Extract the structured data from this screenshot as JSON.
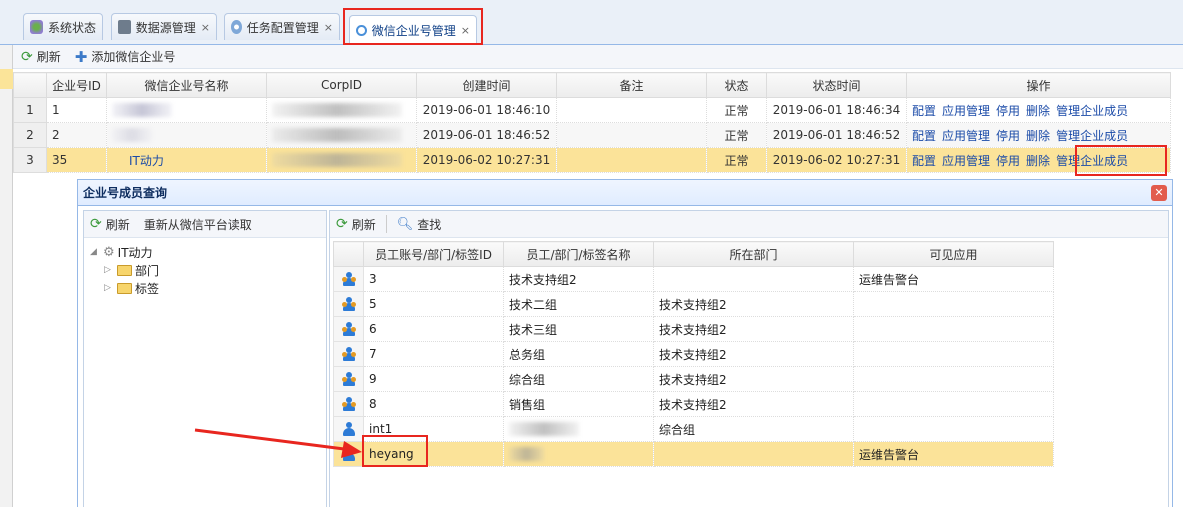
{
  "tabs": [
    {
      "label": "系统状态",
      "closable": false
    },
    {
      "label": "数据源管理",
      "closable": true
    },
    {
      "label": "任务配置管理",
      "closable": true
    },
    {
      "label": "微信企业号管理",
      "closable": true,
      "active": true
    }
  ],
  "toolbar": {
    "refresh": "刷新",
    "add": "添加微信企业号"
  },
  "grid": {
    "headers": [
      "企业号ID",
      "微信企业号名称",
      "CorpID",
      "创建时间",
      "备注",
      "状态",
      "状态时间",
      "操作"
    ],
    "rows": [
      {
        "rn": "1",
        "id": "1",
        "name": "",
        "created": "2019-06-01 18:46:10",
        "note": "",
        "status": "正常",
        "status_time": "2019-06-01 18:46:34"
      },
      {
        "rn": "2",
        "id": "2",
        "name": "",
        "created": "2019-06-01 18:46:52",
        "note": "",
        "status": "正常",
        "status_time": "2019-06-01 18:46:52"
      },
      {
        "rn": "3",
        "id": "35",
        "name": "IT动力",
        "created": "2019-06-02 10:27:31",
        "note": "",
        "status": "正常",
        "status_time": "2019-06-02 10:27:31"
      }
    ],
    "actions": [
      "配置",
      "应用管理",
      "停用",
      "删除",
      "管理企业成员"
    ]
  },
  "dialog": {
    "title": "企业号成员查询",
    "left_toolbar": {
      "refresh": "刷新",
      "reload": "重新从微信平台读取"
    },
    "tree": {
      "root": "IT动力",
      "children": [
        "部门",
        "标签"
      ]
    },
    "right_toolbar": {
      "refresh": "刷新",
      "search": "查找"
    },
    "member_headers": [
      "员工账号/部门/标签ID",
      "员工/部门/标签名称",
      "所在部门",
      "可见应用"
    ],
    "members": [
      {
        "type": "group",
        "id": "3",
        "name": "技术支持组2",
        "dept": "",
        "apps": "运维告警台"
      },
      {
        "type": "group",
        "id": "5",
        "name": "技术二组",
        "dept": "技术支持组2",
        "apps": ""
      },
      {
        "type": "group",
        "id": "6",
        "name": "技术三组",
        "dept": "技术支持组2",
        "apps": ""
      },
      {
        "type": "group",
        "id": "7",
        "name": "总务组",
        "dept": "技术支持组2",
        "apps": ""
      },
      {
        "type": "group",
        "id": "9",
        "name": "综合组",
        "dept": "技术支持组2",
        "apps": ""
      },
      {
        "type": "group",
        "id": "8",
        "name": "销售组",
        "dept": "技术支持组2",
        "apps": ""
      },
      {
        "type": "person",
        "id": "int1",
        "name": "",
        "dept": "综合组",
        "apps": ""
      },
      {
        "type": "person",
        "id": "heyang",
        "name": "",
        "dept": "",
        "apps": "运维告警台"
      }
    ]
  },
  "colors": {
    "accent": "#1b4ba8",
    "highlight": "#fbe399",
    "annotation": "#e8261f"
  }
}
